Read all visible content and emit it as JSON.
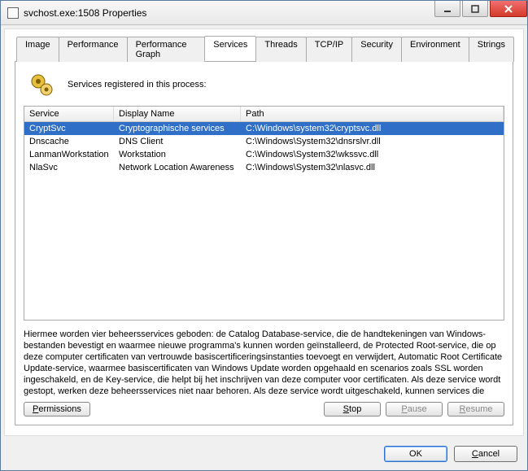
{
  "window": {
    "title": "svchost.exe:1508 Properties"
  },
  "tabs": [
    {
      "label": "Image"
    },
    {
      "label": "Performance"
    },
    {
      "label": "Performance Graph"
    },
    {
      "label": "Services"
    },
    {
      "label": "Threads"
    },
    {
      "label": "TCP/IP"
    },
    {
      "label": "Security"
    },
    {
      "label": "Environment"
    },
    {
      "label": "Strings"
    }
  ],
  "active_tab": "Services",
  "services_panel": {
    "caption": "Services registered in this process:",
    "columns": {
      "service": "Service",
      "display": "Display Name",
      "path": "Path"
    },
    "rows": [
      {
        "service": "CryptSvc",
        "display": "Cryptographische services",
        "path": "C:\\Windows\\system32\\cryptsvc.dll",
        "selected": true
      },
      {
        "service": "Dnscache",
        "display": "DNS Client",
        "path": "C:\\Windows\\System32\\dnsrslvr.dll",
        "selected": false
      },
      {
        "service": "LanmanWorkstation",
        "display": "Workstation",
        "path": "C:\\Windows\\System32\\wkssvc.dll",
        "selected": false
      },
      {
        "service": "NlaSvc",
        "display": "Network Location Awareness",
        "path": "C:\\Windows\\System32\\nlasvc.dll",
        "selected": false
      }
    ],
    "description": "Hiermee worden vier beheersservices geboden: de Catalog Database-service, die de handtekeningen van Windows-bestanden bevestigt en waarmee nieuwe programma's kunnen worden geïnstalleerd, de Protected Root-service, die op deze computer certificaten van vertrouwde basiscertificeringsinstanties toevoegt en verwijdert, Automatic Root Certificate Update-service, waarmee basiscertificaten van Windows Update worden opgehaald en scenarios zoals SSL worden ingeschakeld, en de Key-service, die helpt bij het inschrijven van deze computer voor certificaten. Als deze service wordt gestopt, werken deze beheersservices niet naar behoren. Als deze service wordt uitgeschakeld, kunnen services die",
    "buttons": {
      "permissions": "Permissions",
      "stop": "Stop",
      "pause": "Pause",
      "resume": "Resume",
      "pause_enabled": false,
      "resume_enabled": false
    }
  },
  "dialog_buttons": {
    "ok": "OK",
    "cancel": "Cancel"
  }
}
